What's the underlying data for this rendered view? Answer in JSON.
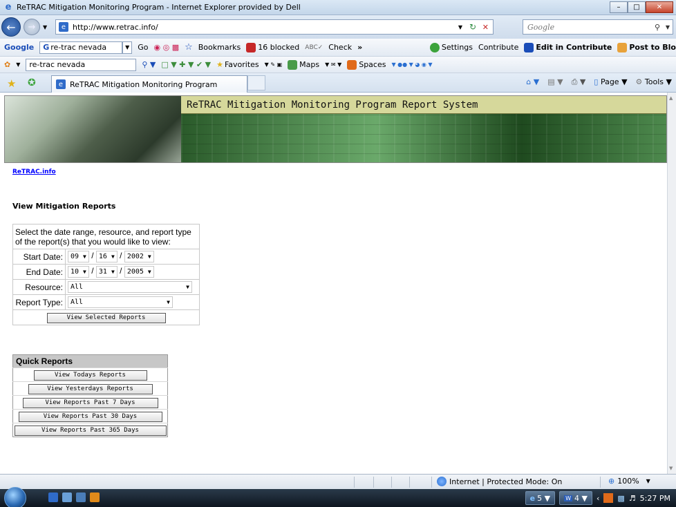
{
  "window": {
    "title": "ReTRAC Mitigation Monitoring Program - Internet Explorer provided by Dell"
  },
  "address_bar": {
    "url": "http://www.retrac.info/",
    "search_placeholder": "Google"
  },
  "google_toolbar": {
    "query": "re-trac nevada",
    "go_label": "Go",
    "bookmarks_label": "Bookmarks",
    "blocked_label": "16 blocked",
    "check_label": "Check",
    "settings_label": "Settings",
    "contribute_label": "Contribute",
    "edit_contribute_label": "Edit in Contribute",
    "post_to_blog_label": "Post to Blo"
  },
  "live_toolbar": {
    "query": "re-trac nevada",
    "favorites_label": "Favorites",
    "maps_label": "Maps",
    "spaces_label": "Spaces"
  },
  "tab": {
    "title": "ReTRAC Mitigation Monitoring Program"
  },
  "command_bar": {
    "page_label": "Page",
    "tools_label": "Tools"
  },
  "page": {
    "banner_title": "ReTRAC Mitigation Monitoring Program Report System",
    "site_link": "ReTRAC.info",
    "heading": "View Mitigation Reports",
    "instructions": "Select the date range, resource, and report type of the report(s) that you would like to view:",
    "start_date": {
      "label": "Start Date:",
      "month": "09",
      "day": "16",
      "year": "2002"
    },
    "end_date": {
      "label": "End Date:",
      "month": "10",
      "day": "31",
      "year": "2005"
    },
    "resource": {
      "label": "Resource:",
      "value": "All"
    },
    "report_type": {
      "label": "Report Type:",
      "value": "All"
    },
    "view_selected": "View Selected Reports",
    "date_sep": "/"
  },
  "quick_reports": {
    "title": "Quick Reports",
    "buttons": [
      "View Todays Reports",
      "View Yesterdays Reports",
      "View Reports Past 7 Days",
      "View Reports Past 30 Days",
      "View Reports Past 365 Days"
    ]
  },
  "status_bar": {
    "zone": "Internet | Protected Mode: On",
    "zoom": "100%"
  },
  "taskbar": {
    "ie_count": "5",
    "word_count": "4",
    "time": "5:27 PM"
  }
}
